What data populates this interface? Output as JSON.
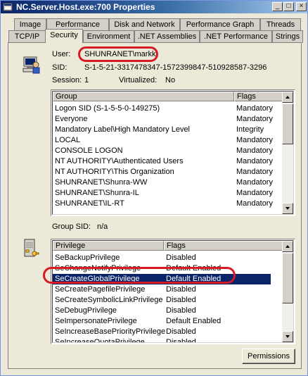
{
  "window": {
    "title": "NC.Server.Host.exe:700 Properties",
    "buttons": {
      "minimize": "_",
      "maximize": "□",
      "close": "×"
    }
  },
  "tabs_row1": [
    "Image",
    "Performance",
    "Disk and Network",
    "Performance Graph",
    "Threads"
  ],
  "tabs_row2": [
    "TCP/IP",
    "Security",
    "Environment",
    ".NET Assemblies",
    ".NET Performance",
    "Strings"
  ],
  "active_tab": "Security",
  "security": {
    "user_label": "User:",
    "user_value": "SHUNRANET\\markk",
    "sid_label": "SID:",
    "sid_value": "S-1-5-21-3317478347-1572399847-510928587-3296",
    "session_label": "Session:",
    "session_value": "1",
    "virtualized_label": "Virtualized:",
    "virtualized_value": "No",
    "group_sid_label": "Group SID:",
    "group_sid_value": "n/a"
  },
  "groups": {
    "headers": [
      "Group",
      "Flags"
    ],
    "rows": [
      [
        "Logon SID (S-1-5-5-0-149275)",
        "Mandatory"
      ],
      [
        "Everyone",
        "Mandatory"
      ],
      [
        "Mandatory Label\\High Mandatory Level",
        "Integrity"
      ],
      [
        "LOCAL",
        "Mandatory"
      ],
      [
        "CONSOLE LOGON",
        "Mandatory"
      ],
      [
        "NT AUTHORITY\\Authenticated Users",
        "Mandatory"
      ],
      [
        "NT AUTHORITY\\This Organization",
        "Mandatory"
      ],
      [
        "SHUNRANET\\Shunra-WW",
        "Mandatory"
      ],
      [
        "SHUNRANET\\Shunra-IL",
        "Mandatory"
      ],
      [
        "SHUNRANET\\IL-RT",
        "Mandatory"
      ]
    ]
  },
  "privileges": {
    "headers": [
      "Privilege",
      "Flags"
    ],
    "rows": [
      [
        "SeBackupPrivilege",
        "Disabled"
      ],
      [
        "SeChangeNotifyPrivilege",
        "Default Enabled"
      ],
      [
        "SeCreateGlobalPrivilege",
        "Default Enabled"
      ],
      [
        "SeCreatePagefilePrivilege",
        "Disabled"
      ],
      [
        "SeCreateSymbolicLinkPrivilege",
        "Disabled"
      ],
      [
        "SeDebugPrivilege",
        "Disabled"
      ],
      [
        "SeImpersonatePrivilege",
        "Default Enabled"
      ],
      [
        "SeIncreaseBasePriorityPrivilege",
        "Disabled"
      ],
      [
        "SeIncreaseQuotaPrivilege",
        "Disabled"
      ]
    ],
    "selected_row": "SeCreateGlobalPrivilege"
  },
  "permissions_button": "Permissions",
  "colors": {
    "titlebar": "#0a246a",
    "selection": "#0a246a",
    "highlight_oval": "#d61a24",
    "window_bg": "#ece9d8"
  },
  "icons": {
    "title": "process-icon",
    "user": "user-computer-icon",
    "privileges": "server-key-icon"
  }
}
